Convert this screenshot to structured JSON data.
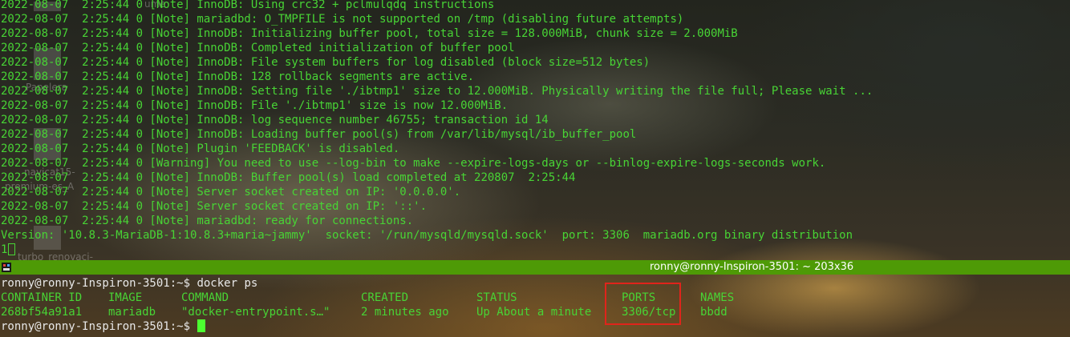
{
  "terminal_top": {
    "lines": [
      "2022-08-07  2:25:44 0 [Note] InnoDB: Using crc32 + pclmulqdq instructions",
      "2022-08-07  2:25:44 0 [Note] mariadbd: O_TMPFILE is not supported on /tmp (disabling future attempts)",
      "2022-08-07  2:25:44 0 [Note] InnoDB: Initializing buffer pool, total size = 128.000MiB, chunk size = 2.000MiB",
      "2022-08-07  2:25:44 0 [Note] InnoDB: Completed initialization of buffer pool",
      "2022-08-07  2:25:44 0 [Note] InnoDB: File system buffers for log disabled (block size=512 bytes)",
      "2022-08-07  2:25:44 0 [Note] InnoDB: 128 rollback segments are active.",
      "2022-08-07  2:25:44 0 [Note] InnoDB: Setting file './ibtmp1' size to 12.000MiB. Physically writing the file full; Please wait ...",
      "2022-08-07  2:25:44 0 [Note] InnoDB: File './ibtmp1' size is now 12.000MiB.",
      "2022-08-07  2:25:44 0 [Note] InnoDB: log sequence number 46755; transaction id 14",
      "2022-08-07  2:25:44 0 [Note] InnoDB: Loading buffer pool(s) from /var/lib/mysql/ib_buffer_pool",
      "2022-08-07  2:25:44 0 [Note] Plugin 'FEEDBACK' is disabled.",
      "2022-08-07  2:25:44 0 [Warning] You need to use --log-bin to make --expire-logs-days or --binlog-expire-logs-seconds work.",
      "2022-08-07  2:25:44 0 [Note] InnoDB: Buffer pool(s) load completed at 220807  2:25:44",
      "2022-08-07  2:25:44 0 [Note] Server socket created on IP: '0.0.0.0'.",
      "2022-08-07  2:25:44 0 [Note] Server socket created on IP: '::'.",
      "2022-08-07  2:25:44 0 [Note] mariadbd: ready for connections.",
      "Version: '10.8.3-MariaDB-1:10.8.3+maria~jammy'  socket: '/run/mysqld/mysqld.sock'  port: 3306  mariadb.org binary distribution"
    ],
    "input_line": "1"
  },
  "pane_divider": {
    "title": "ronny@ronny-Inspiron-3501: ~ 203x36"
  },
  "terminal_bottom": {
    "prompt": "ronny@ronny-Inspiron-3501:~$ ",
    "command": "docker ps",
    "table": {
      "headers": {
        "container_id": "CONTAINER ID",
        "image": "IMAGE",
        "command": "COMMAND",
        "created": "CREATED",
        "status": "STATUS",
        "ports": "PORTS",
        "names": "NAMES"
      },
      "row": {
        "container_id": "268bf54a91a1",
        "image": "mariadb",
        "command": "\"docker-entrypoint.s…\"",
        "created": "2 minutes ago",
        "status": "Up About a minute",
        "ports": "3306/tcp",
        "names": "bbdd"
      }
    },
    "prompt2": "ronny@ronny-Inspiron-3501:~$ "
  },
  "desktop_labels": {
    "label1": "ume",
    "label2": "Papelera",
    "label3": "navicat15-",
    "label4": "premium-es_A",
    "label5": "turbo_renovaci-"
  },
  "colors": {
    "terminal_text": "#48d435",
    "divider": "#4e9a06",
    "highlight_border": "#e0241b",
    "prompt_text": "#e8e8e8"
  }
}
